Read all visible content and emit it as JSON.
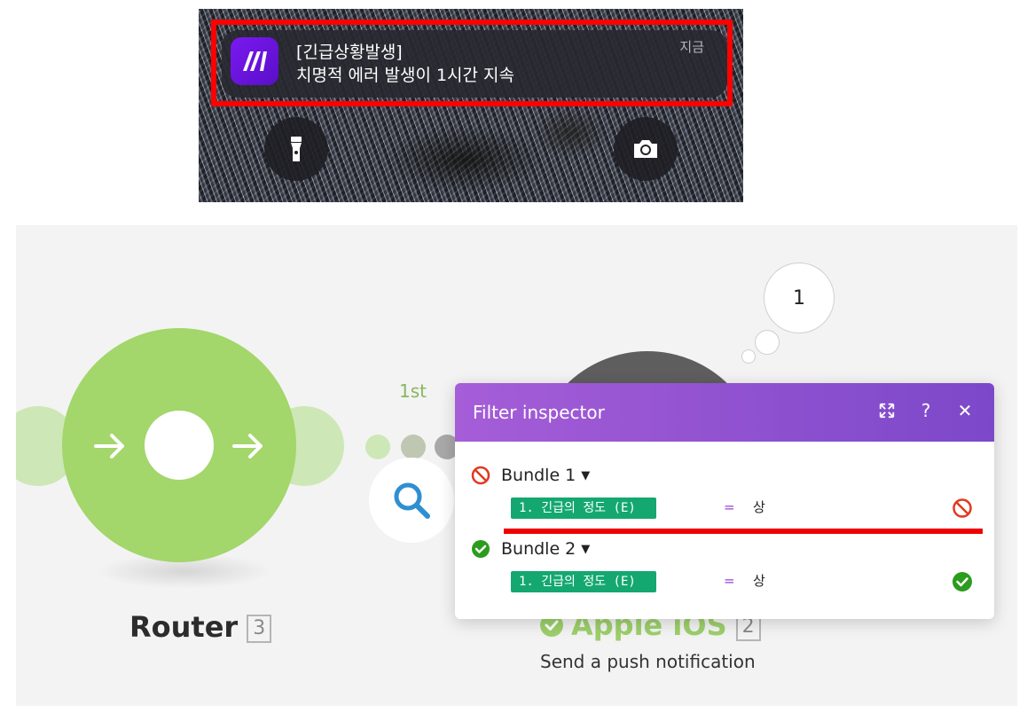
{
  "notification": {
    "title": "[긴급상황발생]",
    "body": "치명적 에러 발생이 1시간 지속",
    "time": "지금"
  },
  "scenario": {
    "router": {
      "label": "Router",
      "badge": "3"
    },
    "route": {
      "label": "1st"
    },
    "ios_module": {
      "label": "Apple iOS",
      "badge": "2",
      "subtitle": "Send a push notification",
      "bubble_count": "1"
    }
  },
  "inspector": {
    "title": "Filter inspector",
    "bundles": [
      {
        "label": "Bundle 1",
        "status": "failed",
        "condition": {
          "field": "1. 긴급의 정도 (E)",
          "operator": "=",
          "value": "상",
          "result": "failed"
        }
      },
      {
        "label": "Bundle 2",
        "status": "passed",
        "condition": {
          "field": "1. 긴급의 정도 (E)",
          "operator": "=",
          "value": "상",
          "result": "passed"
        }
      }
    ]
  },
  "colors": {
    "highlight_red": "#ff0000",
    "router_green": "#a3d66b",
    "inspector_purple": "#8e52d0",
    "tag_green": "#14a870",
    "ok_green": "#2b9c1e",
    "fail_red": "#e0391f"
  },
  "icons": {
    "app": "make-logo-icon",
    "flashlight": "flashlight-icon",
    "camera": "camera-icon",
    "filter": "magnifier-icon",
    "expand": "expand-icon",
    "help": "help-icon",
    "close": "close-icon"
  }
}
